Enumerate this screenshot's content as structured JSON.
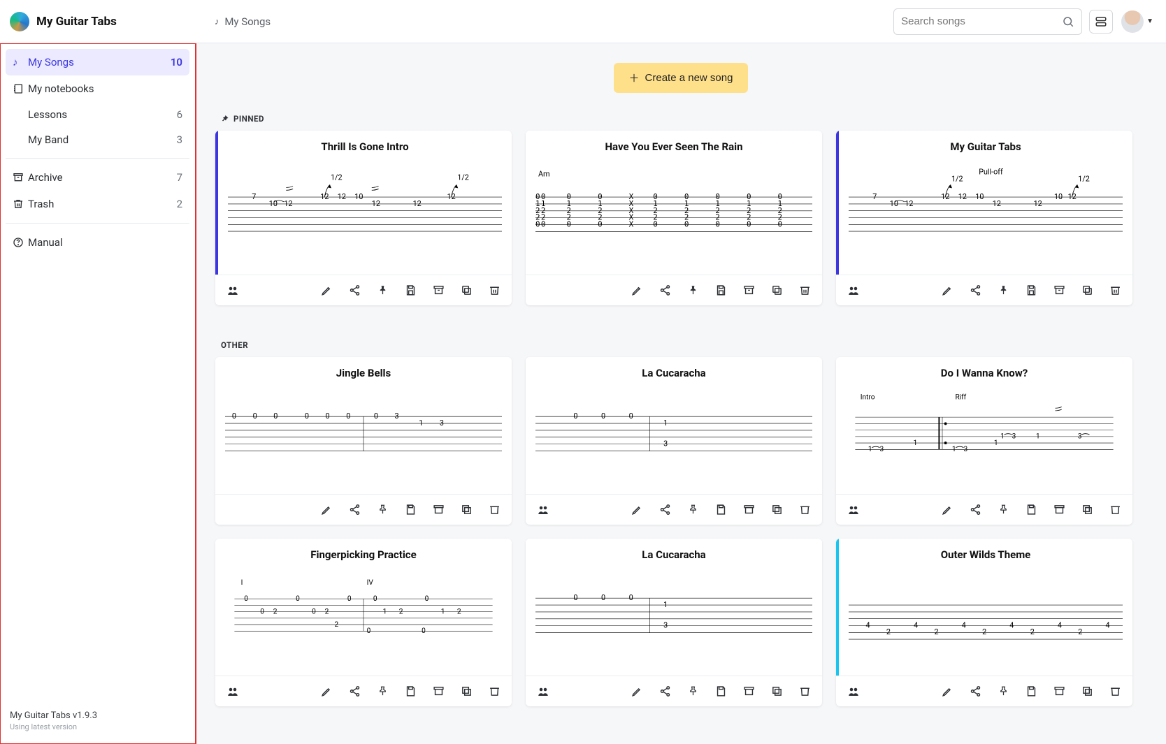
{
  "header": {
    "brand": "My Guitar Tabs",
    "breadcrumb": "My Songs",
    "search_placeholder": "Search songs"
  },
  "sidebar": {
    "my_songs": {
      "label": "My Songs",
      "count": 10
    },
    "notebooks_label": "My notebooks",
    "notebooks": [
      {
        "label": "Lessons",
        "count": 6
      },
      {
        "label": "My Band",
        "count": 3
      }
    ],
    "archive": {
      "label": "Archive",
      "count": 7
    },
    "trash": {
      "label": "Trash",
      "count": 2
    },
    "manual": {
      "label": "Manual"
    },
    "version_line": "My Guitar Tabs v1.9.3",
    "version_sub": "Using latest version"
  },
  "main": {
    "create_label": "Create a new song",
    "pinned_label": "PINNED",
    "other_label": "OTHER",
    "pinned": [
      {
        "title": "Thrill Is Gone Intro",
        "stripe": "blue",
        "shared": true,
        "pinnedSolid": true
      },
      {
        "title": "Have You Ever Seen The Rain",
        "stripe": "",
        "shared": false,
        "pinnedSolid": true
      },
      {
        "title": "My Guitar Tabs",
        "stripe": "blue",
        "shared": true,
        "pinnedSolid": true
      }
    ],
    "other": [
      {
        "title": "Jingle Bells",
        "stripe": "",
        "shared": false,
        "pinnedSolid": false
      },
      {
        "title": "La Cucaracha",
        "stripe": "",
        "shared": true,
        "pinnedSolid": false
      },
      {
        "title": "Do I Wanna Know?",
        "stripe": "",
        "shared": true,
        "pinnedSolid": false
      },
      {
        "title": "Fingerpicking Practice",
        "stripe": "",
        "shared": true,
        "pinnedSolid": false
      },
      {
        "title": "La Cucaracha",
        "stripe": "",
        "shared": true,
        "pinnedSolid": false
      },
      {
        "title": "Outer Wilds Theme",
        "stripe": "cyan",
        "shared": true,
        "pinnedSolid": false
      }
    ]
  },
  "preview_annotations": {
    "card0": {
      "bends": [
        "1/2",
        "1/2"
      ]
    },
    "card1": {
      "chord": "Am"
    },
    "card2": {
      "label": "Pull-off",
      "bends": [
        "1/2",
        "1/2"
      ]
    },
    "card5": {
      "intro": "Intro",
      "riff": "Riff"
    },
    "card6": {
      "c1": "I",
      "c2": "IV"
    }
  }
}
